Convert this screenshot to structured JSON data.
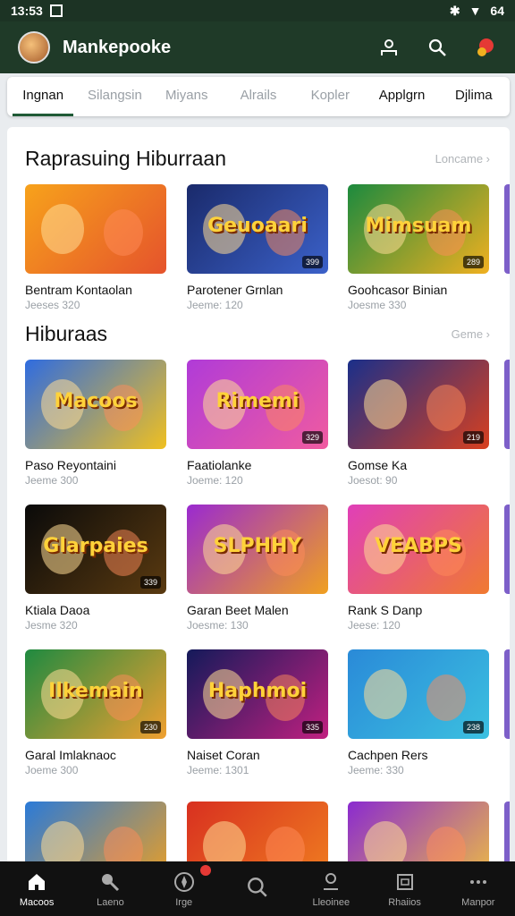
{
  "status": {
    "time": "13:53",
    "battery": "64"
  },
  "app": {
    "title": "Mankepooke"
  },
  "tabs": [
    {
      "label": "Ingnan"
    },
    {
      "label": "Silangsin"
    },
    {
      "label": "Miyans"
    },
    {
      "label": "Alrails"
    },
    {
      "label": "Kopler"
    },
    {
      "label": "Applgrn"
    },
    {
      "label": "Djlima"
    }
  ],
  "sections": [
    {
      "title": "Raprasuing Hiburraan",
      "see_more": "Loncame ›"
    },
    {
      "title": "Hiburaas",
      "see_more": "Geme ›"
    }
  ],
  "cards": [
    {
      "art": "",
      "badge": "",
      "title": "Bentram Kontaolan",
      "sub": "Jeeses 320",
      "c1": "#f7a21b",
      "c2": "#e5532c"
    },
    {
      "art": "Geuoaari",
      "badge": "399",
      "title": "Parotener Grnlan",
      "sub": "Jeeme: 120",
      "c1": "#1a2a6b",
      "c2": "#3b61c9"
    },
    {
      "art": "Mimsuam",
      "badge": "289",
      "title": "Goohcasor Binian",
      "sub": "Joesme 330",
      "c1": "#1c8a3e",
      "c2": "#f0b020"
    },
    {
      "art": "Macoos",
      "badge": "",
      "title": "Paso Reyontaini",
      "sub": "Jeeme 300",
      "c1": "#2f6ce0",
      "c2": "#f0c020"
    },
    {
      "art": "Rimemi",
      "badge": "329",
      "title": "Faatiolanke",
      "sub": "Joeme: 120",
      "c1": "#b03bd8",
      "c2": "#f05ba0"
    },
    {
      "art": "",
      "badge": "219",
      "title": "Gomse Ka",
      "sub": "Joesot: 90",
      "c1": "#1a2f8a",
      "c2": "#d8401f"
    },
    {
      "art": "Glarpaies",
      "badge": "339",
      "title": "Ktiala Daoa",
      "sub": "Jesme 320",
      "c1": "#0a0a0a",
      "c2": "#5a3a10"
    },
    {
      "art": "SLPHHY",
      "badge": "",
      "title": "Garan Beet Malen",
      "sub": "Joesme: 130",
      "c1": "#9a2ad0",
      "c2": "#f0a020"
    },
    {
      "art": "VEABPS",
      "badge": "",
      "title": "Rank S Danp",
      "sub": "Jeese: 120",
      "c1": "#e03fb8",
      "c2": "#f07a30"
    },
    {
      "art": "Ilkemain",
      "badge": "230",
      "title": "Garal Imlaknaoc",
      "sub": "Joeme 300",
      "c1": "#1f8a40",
      "c2": "#f0a030"
    },
    {
      "art": "Haphmoi",
      "badge": "335",
      "title": "Naiset Coran",
      "sub": "Jeeme: 1301",
      "c1": "#141a5a",
      "c2": "#c02080"
    },
    {
      "art": "",
      "badge": "238",
      "title": "Cachpen Rers",
      "sub": "Jeeme: 330",
      "c1": "#2a8ad8",
      "c2": "#3bc0e0"
    },
    {
      "art": "",
      "badge": "",
      "title": "",
      "sub": "",
      "c1": "#2a7ad8",
      "c2": "#f0a020"
    },
    {
      "art": "",
      "badge": "",
      "title": "",
      "sub": "",
      "c1": "#d83020",
      "c2": "#f08020"
    },
    {
      "art": "",
      "badge": "",
      "title": "",
      "sub": "",
      "c1": "#8a2ad0",
      "c2": "#f0c040"
    }
  ],
  "nav": [
    {
      "label": "Macoos"
    },
    {
      "label": "Laeno"
    },
    {
      "label": "Irge"
    },
    {
      "label": ""
    },
    {
      "label": "Lleoinee"
    },
    {
      "label": "Rhaiios"
    },
    {
      "label": "Manpor"
    }
  ]
}
